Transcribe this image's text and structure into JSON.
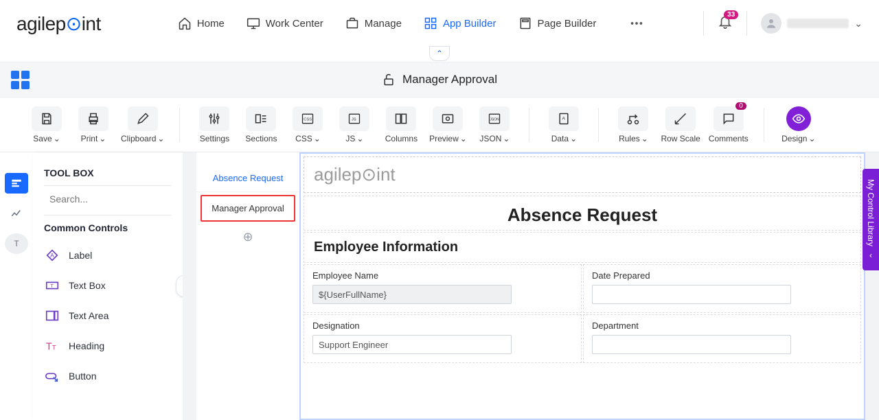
{
  "nav": {
    "logo_a": "agilep",
    "logo_b": "int",
    "items": [
      {
        "label": "Home"
      },
      {
        "label": "Work Center"
      },
      {
        "label": "Manage"
      },
      {
        "label": "App Builder"
      },
      {
        "label": "Page Builder"
      }
    ],
    "bell_count": "33"
  },
  "titlebar": {
    "title": "Manager Approval"
  },
  "toolbar": {
    "save": "Save",
    "print": "Print",
    "clipboard": "Clipboard",
    "settings": "Settings",
    "sections": "Sections",
    "css": "CSS",
    "js": "JS",
    "columns": "Columns",
    "preview": "Preview",
    "json": "JSON",
    "data": "Data",
    "rules": "Rules",
    "rowscale": "Row Scale",
    "comments": "Comments",
    "design": "Design"
  },
  "sidebar": {
    "title": "TOOL BOX",
    "search_placeholder": "Search...",
    "group": "Common Controls",
    "controls": [
      {
        "label": "Label"
      },
      {
        "label": "Text Box"
      },
      {
        "label": "Text Area"
      },
      {
        "label": "Heading"
      },
      {
        "label": "Button"
      }
    ]
  },
  "form_tabs": {
    "tab1": "Absence Request",
    "tab2": "Manager Approval"
  },
  "form": {
    "title": "Absence Request",
    "section": "Employee Information",
    "rows": [
      {
        "left_label": "Employee Name",
        "left_value": "${UserFullName}",
        "right_label": "Date Prepared",
        "right_value": ""
      },
      {
        "left_label": "Designation",
        "left_value": "Support Engineer",
        "right_label": "Department",
        "right_value": ""
      }
    ]
  },
  "side_panel": "My Control Library"
}
